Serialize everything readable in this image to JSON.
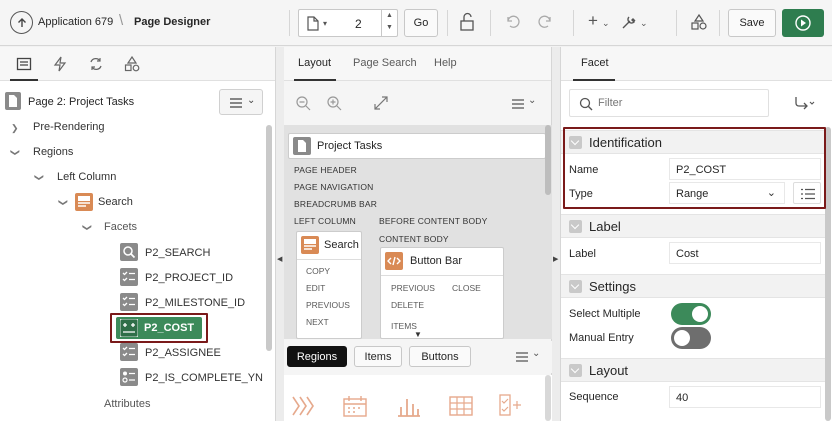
{
  "toolbar": {
    "app_link": "Application 679",
    "page_designer": "Page Designer",
    "page_number": "2",
    "go_label": "Go",
    "save_label": "Save"
  },
  "left_panel": {
    "page_title": "Page 2: Project Tasks",
    "tree": {
      "pre_rendering": "Pre-Rendering",
      "regions": "Regions",
      "left_column": "Left Column",
      "search": "Search",
      "facets": "Facets",
      "items": [
        "P2_SEARCH",
        "P2_PROJECT_ID",
        "P2_MILESTONE_ID",
        "P2_COST",
        "P2_ASSIGNEE",
        "P2_IS_COMPLETE_YN"
      ],
      "attributes": "Attributes"
    }
  },
  "mid_panel": {
    "tabs": [
      "Layout",
      "Page Search",
      "Help"
    ],
    "page_title": "Project Tasks",
    "positions": [
      "PAGE HEADER",
      "PAGE NAVIGATION",
      "BREADCRUMB BAR",
      "LEFT COLUMN",
      "BEFORE CONTENT BODY",
      "CONTENT BODY"
    ],
    "search_card": {
      "title": "Search",
      "items": [
        "COPY",
        "EDIT",
        "PREVIOUS",
        "NEXT"
      ]
    },
    "button_bar_card": {
      "title": "Button Bar",
      "items_left": [
        "PREVIOUS",
        "DELETE",
        "ITEMS"
      ],
      "items_right": [
        "CLOSE"
      ]
    },
    "gallery_tabs": [
      "Regions",
      "Items",
      "Buttons"
    ]
  },
  "right_panel": {
    "tab": "Facet",
    "filter_placeholder": "Filter",
    "identification": {
      "title": "Identification",
      "name_label": "Name",
      "name_value": "P2_COST",
      "type_label": "Type",
      "type_value": "Range"
    },
    "label_section": {
      "title": "Label",
      "label_label": "Label",
      "label_value": "Cost"
    },
    "settings": {
      "title": "Settings",
      "select_multiple_label": "Select Multiple",
      "select_multiple_on": true,
      "manual_entry_label": "Manual Entry",
      "manual_entry_on": false
    },
    "layout": {
      "title": "Layout",
      "sequence_label": "Sequence",
      "sequence_value": "40"
    }
  },
  "colors": {
    "accent_green": "#3c8a5a",
    "highlight": "#7a1a1a",
    "search_icon": "#d98a55"
  }
}
